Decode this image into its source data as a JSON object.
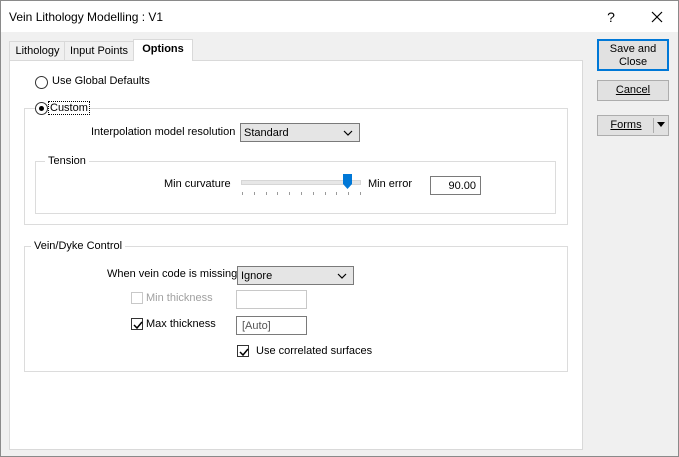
{
  "window": {
    "title": "Vein Lithology Modelling : V1",
    "help_glyph": "?"
  },
  "tabs": [
    {
      "label": "Lithology",
      "active": false
    },
    {
      "label": "Input Points",
      "active": false
    },
    {
      "label": "Options",
      "active": true
    }
  ],
  "options": {
    "use_global_defaults": {
      "label": "Use Global Defaults",
      "selected": false
    },
    "custom": {
      "label": "Custom",
      "selected": true
    },
    "interpolation": {
      "label": "Interpolation model resolution",
      "value": "Standard"
    },
    "tension": {
      "title": "Tension",
      "min_label": "Min curvature",
      "max_label": "Min error",
      "value": "90.00",
      "slider_level_percent": 90
    }
  },
  "vein_dyke": {
    "title": "Vein/Dyke Control",
    "missing_code": {
      "label": "When vein code is missing",
      "value": "Ignore"
    },
    "min_thickness": {
      "label": "Min thickness",
      "checked": false,
      "enabled": false,
      "value": ""
    },
    "max_thickness": {
      "label": "Max thickness",
      "checked": true,
      "enabled": true,
      "value": "[Auto]"
    },
    "correlated": {
      "label": "Use correlated surfaces",
      "checked": true
    }
  },
  "buttons": {
    "save_close_line1": "Save and",
    "save_close_line2": "Close",
    "cancel": "Cancel",
    "forms": "Forms"
  }
}
